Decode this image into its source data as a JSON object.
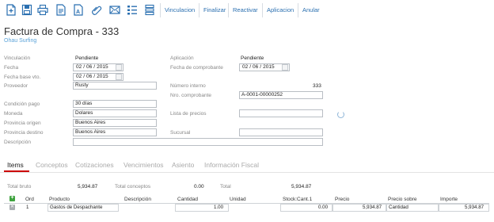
{
  "toolbar": {
    "icons": [
      "new-document-icon",
      "save-icon",
      "print-icon",
      "export-pdf-icon",
      "text-document-icon",
      "attachment-icon",
      "email-icon",
      "list-icon",
      "stacked-icon"
    ],
    "actions": [
      "Vinculacion",
      "Finalizar",
      "Reactivar",
      "Aplicacion",
      "Anular"
    ]
  },
  "header": {
    "title": "Factura de Compra - 333",
    "subtitle": "Ohau Surfing"
  },
  "form": {
    "vinculacion": {
      "label": "Vinculación",
      "value": "Pendiente"
    },
    "fecha": {
      "label": "Fecha",
      "day": "02",
      "month": "06",
      "year": "2015"
    },
    "fecha_base_vto": {
      "label": "Fecha base vto.",
      "day": "02",
      "month": "06",
      "year": "2015"
    },
    "proveedor": {
      "label": "Proveedor",
      "value": "Rusty"
    },
    "condicion_pago": {
      "label": "Condición pago",
      "value": "30 días"
    },
    "moneda": {
      "label": "Moneda",
      "value": "Dolares"
    },
    "provincia_origen": {
      "label": "Provincia origen",
      "value": "Buenos Aires"
    },
    "provincia_destino": {
      "label": "Provincia destino",
      "value": "Buenos Aires"
    },
    "descripcion": {
      "label": "Descripción",
      "value": ""
    },
    "aplicacion": {
      "label": "Aplicación",
      "value": "Pendiente"
    },
    "fecha_comprobante": {
      "label": "Fecha de comprobante",
      "day": "02",
      "month": "06",
      "year": "2015"
    },
    "numero_interno": {
      "label": "Número interno",
      "value": "333"
    },
    "nro_comprobante": {
      "label": "Nro. comprobante",
      "value": "A-0001-00000252"
    },
    "lista_precios": {
      "label": "Lista de precios",
      "value": ""
    },
    "sucursal": {
      "label": "Sucursal",
      "value": ""
    }
  },
  "tabs": [
    "Items",
    "Conceptos",
    "Cotizaciones",
    "Vencimientos",
    "Asiento",
    "Información Fiscal"
  ],
  "totals": {
    "total_bruto_label": "Total bruto",
    "total_bruto": "5,934.87",
    "total_conceptos_label": "Total conceptos",
    "total_conceptos": "0.00",
    "total_label": "Total",
    "total": "5,934.87"
  },
  "grid": {
    "columns": [
      "Ord",
      "Producto",
      "Descripción",
      "Cantidad",
      "Unidad",
      "Stock:Cant.1",
      "Precio",
      "Precio sobre",
      "Importe"
    ],
    "rows": [
      {
        "ord": "1",
        "producto": "Gastos de Despachante",
        "descripcion": "",
        "cantidad": "1.00",
        "unidad": "",
        "stock": "0.00",
        "precio": "5,934.87",
        "precio_sobre": "Cantidad",
        "importe": "5,934.87"
      }
    ]
  },
  "colors": {
    "accent": "#2a6fb0",
    "tab_active": "#cc0000",
    "add": "#3fa33f"
  }
}
